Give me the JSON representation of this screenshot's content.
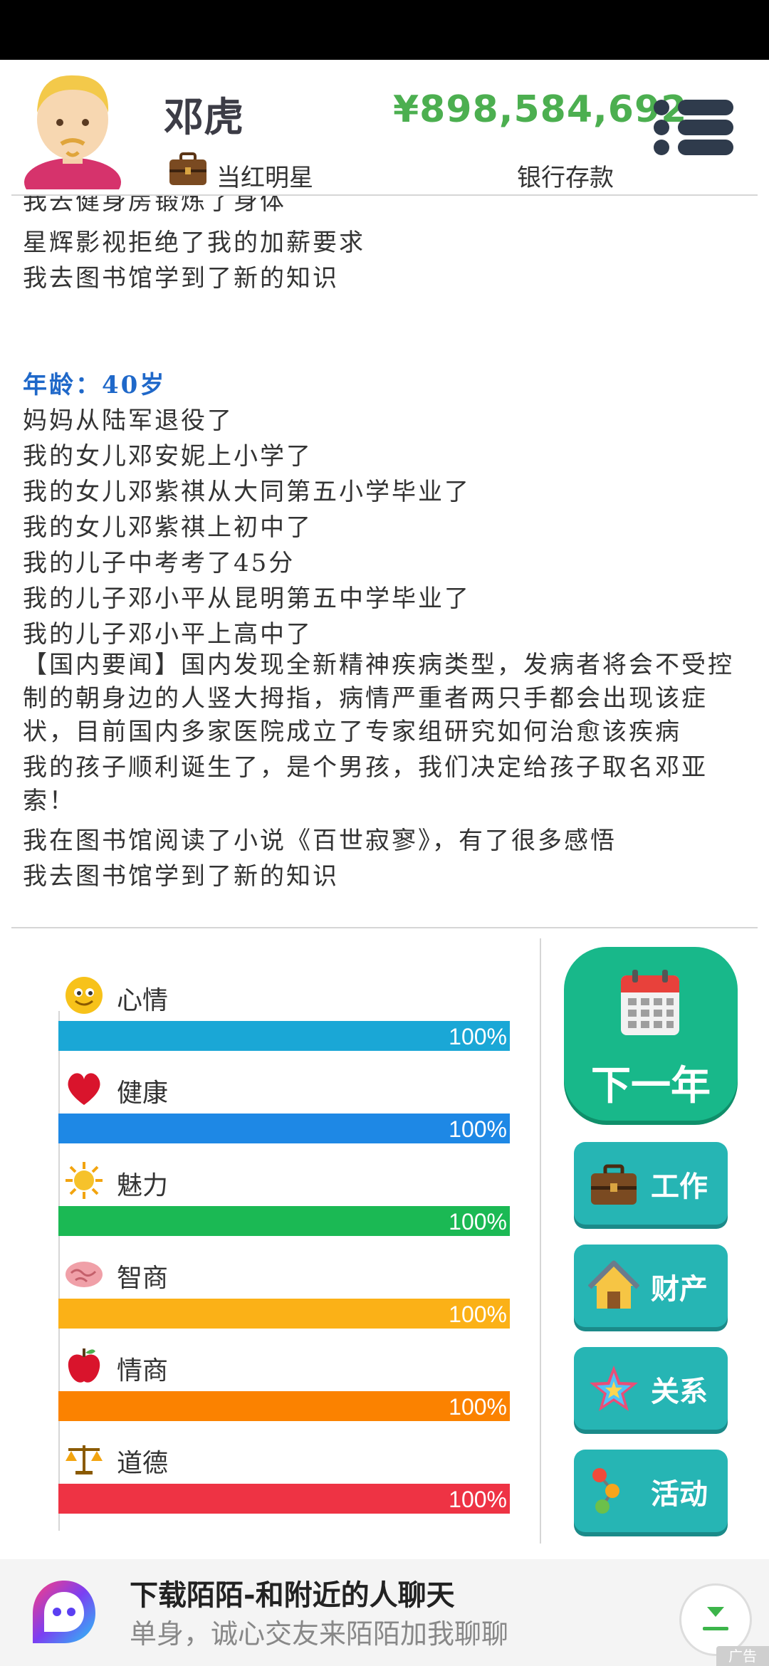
{
  "header": {
    "name": "邓虎",
    "job": "当红明星",
    "money": "¥898,584,692",
    "bank_label": "银行存款"
  },
  "log": {
    "partial_top": "我去健身房锻炼了身体",
    "lines_before": [
      "星辉影视拒绝了我的加薪要求",
      "我去图书馆学到了新的知识"
    ],
    "age_heading": "年龄：40岁",
    "lines_after": [
      "妈妈从陆军退役了",
      "我的女儿邓安妮上小学了",
      "我的女儿邓紫祺从大同第五小学毕业了",
      "我的女儿邓紫祺上初中了",
      "我的儿子中考考了45分",
      "我的儿子邓小平从昆明第五中学毕业了",
      "我的儿子邓小平上高中了"
    ],
    "news": "【国内要闻】国内发现全新精神疾病类型，发病者将会不受控制的朝身边的人竖大拇指，病情严重者两只手都会出现该症状，目前国内多家医院成立了专家组研究如何治愈该疾病",
    "birth": "我的孩子顺利诞生了，是个男孩，我们决定给孩子取名邓亚索！",
    "library_read": "我在图书馆阅读了小说《百世寂寥》，有了很多感悟",
    "library_learn": "我去图书馆学到了新的知识"
  },
  "stats": [
    {
      "label": "心情",
      "icon": "smiley-icon",
      "value": 1.0,
      "pct": "100%",
      "color": "#1aa7d6"
    },
    {
      "label": "健康",
      "icon": "heart-icon",
      "value": 1.0,
      "pct": "100%",
      "color": "#1e88e5"
    },
    {
      "label": "魅力",
      "icon": "sun-icon",
      "value": 1.0,
      "pct": "100%",
      "color": "#1bb954"
    },
    {
      "label": "智商",
      "icon": "brain-icon",
      "value": 1.0,
      "pct": "100%",
      "color": "#fbb117"
    },
    {
      "label": "情商",
      "icon": "apple-icon",
      "value": 1.0,
      "pct": "100%",
      "color": "#fb8200"
    },
    {
      "label": "道德",
      "icon": "scales-icon",
      "value": 1.0,
      "pct": "100%",
      "color": "#ee3344"
    }
  ],
  "actions": {
    "next_year": "下一年",
    "work": "工作",
    "property": "财产",
    "relations": "关系",
    "activities": "活动"
  },
  "ad": {
    "title": "下载陌陌-和附近的人聊天",
    "subtitle": "单身，诚心交友来陌陌加我聊聊",
    "tag": "广告"
  }
}
